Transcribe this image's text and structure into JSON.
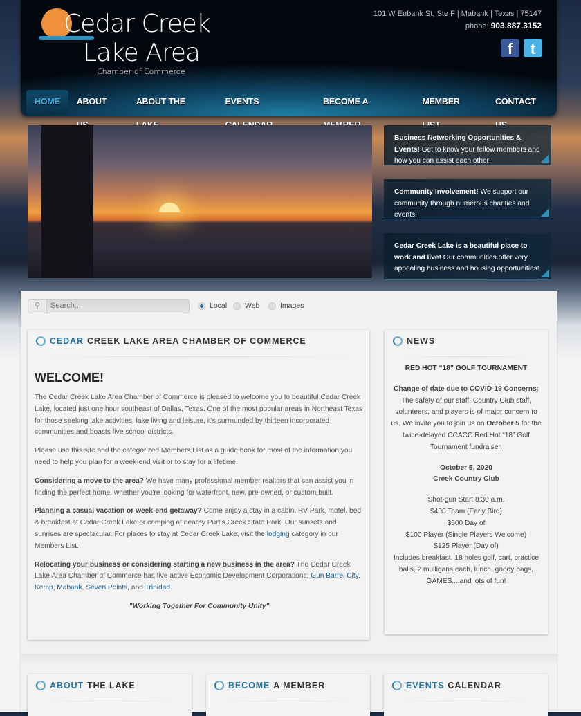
{
  "header": {
    "logo": {
      "line1": "Cedar Creek",
      "line2": "Lake Area",
      "line3": "Chamber of Commerce"
    },
    "address": "101 W Eubank St, Ste F | Mabank | Texas | 75147",
    "phone_label": "phone:",
    "phone": "903.887.3152",
    "social": [
      {
        "icon": "facebook-icon",
        "glyph": "f",
        "color": "#3b5998"
      },
      {
        "icon": "twitter-icon",
        "glyph": "t",
        "color": "#4ab3e6"
      }
    ]
  },
  "nav": [
    "HOME",
    "ABOUT US",
    "ABOUT THE LAKE",
    "EVENTS CALENDAR",
    "BECOME A MEMBER",
    "MEMBER LIST",
    "CONTACT US"
  ],
  "features": [
    {
      "bold": "Business Networking Opportunities & Events!",
      "text": " Get to know your fellow members and how you can assist each other!"
    },
    {
      "bold": "Community Involvement!",
      "text": " We support our community through numerous charities and events!"
    },
    {
      "bold": "Cedar Creek Lake is a beautiful place to work and live!",
      "text": " Our communities offer very appealing business and housing opportunities!"
    }
  ],
  "search": {
    "placeholder": "Search...",
    "options": [
      "Local",
      "Web",
      "Images"
    ],
    "selected": "Local"
  },
  "main": {
    "title_blue": "CEDAR",
    "title_rest": "CREEK LAKE AREA CHAMBER OF COMMERCE",
    "heading": "WELCOME!",
    "p1": "The Cedar Creek Lake Area Chamber of Commerce is pleased to welcome you to beautiful Cedar Creek Lake, located just one hour southeast of Dallas, Texas. One of the most popular areas in Northeast Texas for those seeking lake activities, lake living and leisure, it's surrounded by thirteen incorporated communities and boasts five school districts.",
    "p2": "Please use this site and the categorized Members List as a guide book for most of the information you need to help you plan for a week-end visit or to stay for a lifetime.",
    "p3_bold": "Considering a move to the area?",
    "p3": " We have many professional member realtors that can assist you in finding the perfect home, whether you're looking for waterfront, new, pre-owned, or custom built.",
    "p4_bold": "Planning a casual vacation or week-end getaway?",
    "p4a": " Come enjoy a stay in a cabin, RV Park, motel, bed & breakfast at Cedar Creek Lake or camping at nearby Purtis Creek State Park. Our sunsets and sunrises are spectacular. For places to stay at Cedar Creek Lake, visit the ",
    "p4_link": "lodging",
    "p4b": " category in our Members List.",
    "p5_bold": "Relocating your business or considering starting a new business in the area?",
    "p5": " The Cedar Creek Lake Area Chamber of Commerce has five active Economic Development Corporations; ",
    "links": [
      "Gun Barrel City",
      "Kemp",
      "Mabank",
      "Seven Points",
      "Trinidad"
    ],
    "and": "and",
    "motto": "\"Working Together For Community Unity\""
  },
  "news": {
    "title": "NEWS",
    "headline": "RED HOT “18” GOLF TOURNAMENT",
    "p1_bold": "Change of date due to COVID-19 Concerns:",
    "p1a": " The safety of our staff, Country Club staff, volunteers, and players is of major concern to us. We invite you to join us on ",
    "p1_date": "October 5",
    "p1b": " for the twice-delayed CCACC Red Hot “18” Golf Tournament fundraiser.",
    "date": "October 5, 2020",
    "venue": "Creek Country Club",
    "details": [
      "Shot-gun Start 8:30 a.m.",
      "$400 Team (Early Bird)",
      "$500 Day of",
      "$100 Player (Single Players Welcome)",
      "$125 Player (Day of)",
      "Includes breakfast, 18 holes golf, cart, practice balls, 2 mulligans each, lunch, goody bags, GAMES....and lots of fun!"
    ]
  },
  "bottom": [
    {
      "blue": "ABOUT",
      "rest": "THE LAKE"
    },
    {
      "blue": "BECOME",
      "rest": "A MEMBER"
    },
    {
      "blue": "EVENTS",
      "rest": "CALENDAR"
    }
  ]
}
